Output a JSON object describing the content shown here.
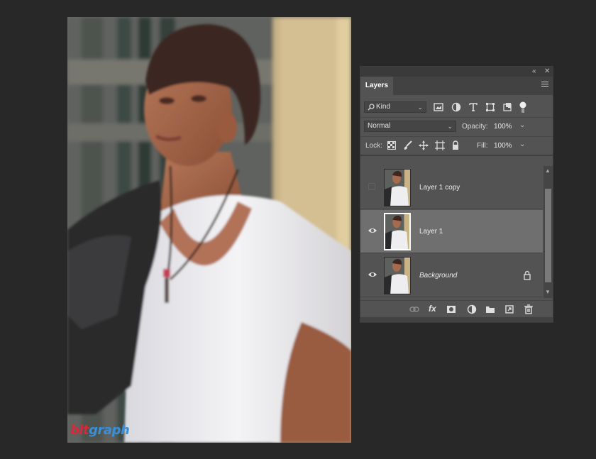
{
  "canvas": {
    "watermark_part1": "bit",
    "watermark_part2": "graph"
  },
  "panel": {
    "title": "Layers",
    "kind_filter": {
      "value": "Kind"
    },
    "blend_mode": "Normal",
    "opacity": {
      "label": "Opacity:",
      "value": "100%"
    },
    "lock": {
      "label": "Lock:"
    },
    "fill": {
      "label": "Fill:",
      "value": "100%"
    },
    "layers": [
      {
        "name": "Layer 1 copy",
        "visible": false,
        "selected": false,
        "locked": false
      },
      {
        "name": "Layer 1",
        "visible": true,
        "selected": true,
        "locked": false
      },
      {
        "name": "Background",
        "visible": true,
        "selected": false,
        "locked": true
      }
    ],
    "filter_icons": [
      "image-filter-icon",
      "adjustment-filter-icon",
      "type-filter-icon",
      "shape-filter-icon",
      "smart-object-filter-icon",
      "filter-toggle-icon"
    ],
    "lock_icons": [
      "lock-transparent-pixels-icon",
      "lock-image-pixels-icon",
      "lock-position-icon",
      "lock-artboard-icon",
      "lock-all-icon"
    ],
    "bottom_icons": [
      "link-layers-icon",
      "fx-icon",
      "add-mask-icon",
      "adjustment-layer-icon",
      "new-group-icon",
      "new-layer-icon",
      "delete-layer-icon"
    ],
    "fx_label": "fx"
  },
  "colors": {
    "app_bg": "#282828",
    "panel_bg": "#535353",
    "selected_row": "#6f6f6f",
    "watermark_red": "#d8283a",
    "watermark_blue": "#3a8fd8"
  }
}
